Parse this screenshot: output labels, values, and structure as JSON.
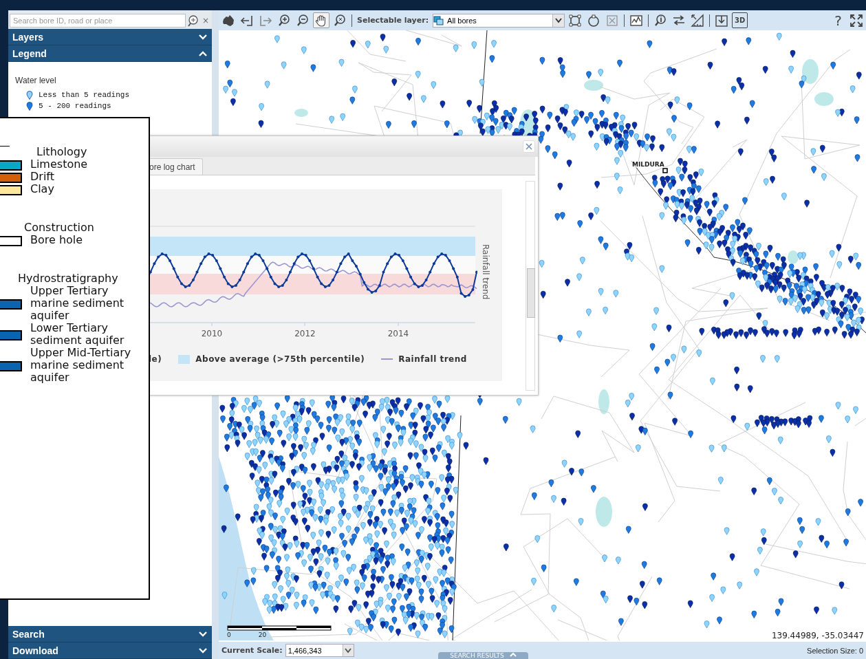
{
  "search_field": {
    "placeholder": "Search bore ID, road or place",
    "clear_symbol": "×"
  },
  "panels": [
    {
      "title": "Layers",
      "expanded": false
    },
    {
      "title": "Legend",
      "expanded": true
    },
    {
      "title": "Search",
      "expanded": false
    },
    {
      "title": "Download",
      "expanded": false
    }
  ],
  "legend": {
    "heading": "Water level",
    "items": [
      {
        "label": "Less than 5 readings",
        "color": "#8fd3ff"
      },
      {
        "label": "5 - 200 readings",
        "color": "#1e7be0"
      }
    ]
  },
  "toolbar": {
    "tools": [
      {
        "kind": "full-extent",
        "selected": false
      },
      {
        "kind": "back",
        "selected": false
      },
      {
        "kind": "forward",
        "selected": false
      },
      {
        "kind": "zoom-in",
        "selected": false
      },
      {
        "kind": "zoom-out",
        "selected": false
      },
      {
        "kind": "pan",
        "selected": true
      },
      {
        "kind": "zoom-xy",
        "selected": false
      }
    ],
    "layer_select": {
      "label": "Selectable layer:",
      "value": "All bores"
    },
    "tools_after": [
      {
        "kind": "rect-select"
      },
      {
        "kind": "circle-select"
      },
      {
        "kind": "clear-select"
      },
      {
        "kind": "separator"
      },
      {
        "kind": "chart"
      },
      {
        "kind": "separator"
      },
      {
        "kind": "identify"
      },
      {
        "kind": "transfer"
      },
      {
        "kind": "measure"
      },
      {
        "kind": "separator"
      },
      {
        "kind": "download"
      },
      {
        "kind": "perspective",
        "label": "3D"
      }
    ],
    "end_tools": [
      {
        "kind": "help",
        "label": "?"
      },
      {
        "kind": "fullscreen"
      }
    ]
  },
  "map": {
    "place_label": "MILDURA",
    "scale_labels": [
      "0",
      "20"
    ],
    "coordinates": "139.44989, -35.03447"
  },
  "status_bar": {
    "scale_label": "Current Scale:",
    "scale_value": "1,466,343",
    "results_tab": "SEARCH RESULTS",
    "selection": "Selection Size: 0"
  },
  "bore_dialog": {
    "tabs": [
      {
        "label": "ore log chart",
        "selected": true
      }
    ],
    "x_ticks": [
      "2010",
      "2012",
      "2014"
    ],
    "axis_title": "Rainfall trend",
    "legend": [
      {
        "kind": "band",
        "label": "le)",
        "color": "#f8dadb"
      },
      {
        "kind": "band",
        "label": "Above average (>75th percentile)",
        "color": "#c4e4f7"
      },
      {
        "kind": "line",
        "label": "Rainfall trend",
        "color": "#9c96cf"
      }
    ]
  },
  "log_legend": {
    "groups": [
      {
        "title": "Lithology",
        "items": [
          {
            "label": "Limestone",
            "color": "#0aa8c8"
          },
          {
            "label": "Drift",
            "color": "#d2600a"
          },
          {
            "label": "Clay",
            "color": "#fde79a"
          }
        ]
      },
      {
        "title": "Construction",
        "items": [
          {
            "label": "Bore hole",
            "color": "#ffffff"
          }
        ]
      },
      {
        "title": "Hydrostratigraphy",
        "items": [
          {
            "label": "Upper Tertiary marine sediment aquifer",
            "color": "#0a64b0"
          },
          {
            "label": "Lower Tertiary sediment aquifer",
            "color": "#0a64b0"
          },
          {
            "label": "Upper Mid-Tertiary marine sediment aquifer",
            "color": "#0a64b0"
          }
        ]
      }
    ]
  }
}
